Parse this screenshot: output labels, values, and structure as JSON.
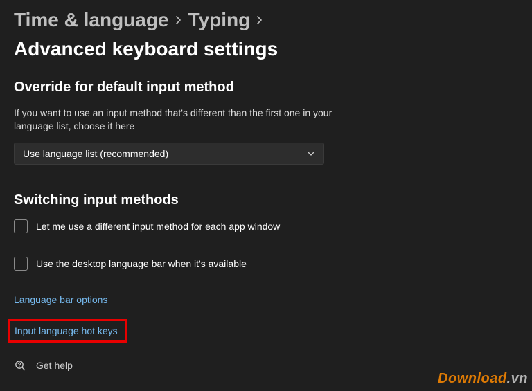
{
  "breadcrumb": {
    "level1": "Time & language",
    "level2": "Typing",
    "current": "Advanced keyboard settings"
  },
  "section_override": {
    "title": "Override for default input method",
    "desc": "If you want to use an input method that's different than the first one in your language list, choose it here",
    "dropdown_value": "Use language list (recommended)"
  },
  "section_switching": {
    "title": "Switching input methods",
    "checkbox1": "Let me use a different input method for each app window",
    "checkbox2": "Use the desktop language bar when it's available"
  },
  "links": {
    "language_bar_options": "Language bar options",
    "input_language_hotkeys": "Input language hot keys"
  },
  "help": {
    "label": "Get help"
  },
  "watermark": {
    "main": "Download",
    "suffix": ".vn"
  }
}
